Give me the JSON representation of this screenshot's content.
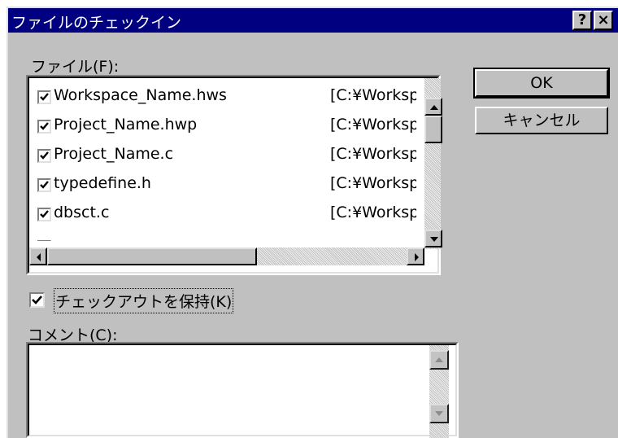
{
  "window": {
    "title": "ファイルのチェックイン",
    "help_glyph": "?",
    "close_glyph": "×"
  },
  "files_label": "ファイル(F):",
  "files": [
    {
      "name": "Workspace_Name.hws",
      "path": "[C:¥Worksp",
      "checked": true
    },
    {
      "name": "Project_Name.hwp",
      "path": "[C:¥Worksp",
      "checked": true
    },
    {
      "name": "Project_Name.c",
      "path": "[C:¥Worksp",
      "checked": true
    },
    {
      "name": "typedefine.h",
      "path": "[C:¥Worksp",
      "checked": true
    },
    {
      "name": "dbsct.c",
      "path": "[C:¥Worksp",
      "checked": true
    }
  ],
  "keep_checkout": {
    "label": "チェックアウトを保持(K)",
    "checked": true
  },
  "comment_label": "コメント(C):",
  "comment_value": "",
  "buttons": {
    "ok": "OK",
    "cancel": "キャンセル"
  },
  "icons": {
    "scroll_up": "triangle-up-icon",
    "scroll_down": "triangle-down-icon",
    "scroll_left": "triangle-left-icon",
    "scroll_right": "triangle-right-icon",
    "check": "checkmark-icon"
  },
  "colors": {
    "titlebar": "#000080",
    "face": "#c0c0c0",
    "window": "#ffffff"
  }
}
